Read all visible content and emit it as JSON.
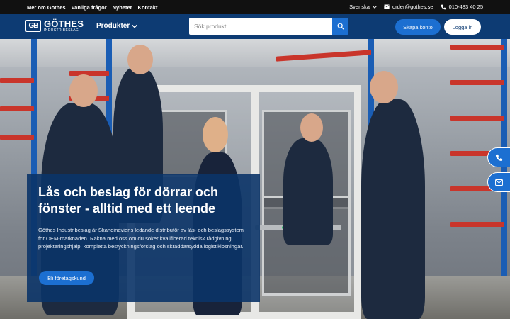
{
  "topbar": {
    "links": [
      "Mer om Göthes",
      "Vanliga frågor",
      "Nyheter",
      "Kontakt"
    ],
    "language": "Svenska",
    "email": "order@gothes.se",
    "phone": "010-483 40 25"
  },
  "header": {
    "logo_mark": "GB",
    "logo_brand": "GÖTHES",
    "logo_sub": "INDUSTRIBESLAG",
    "products_label": "Produkter",
    "search_placeholder": "Sök produkt",
    "create_account_label": "Skapa konto",
    "login_label": "Logga in"
  },
  "hero": {
    "title": "Lås och beslag för dörrar och fönster - alltid med ett leende",
    "description": "Göthes Industribeslag är Skandinaviens ledande distributör av lås- och beslagssystem för OEM-marknaden. Räkna med oss om du söker kvalificerad teknisk rådgivning, projekteringshjälp, kompletta bestyckningsförslag och skräddarsydda logistiklösningar.",
    "cta_label": "Bli företagskund"
  },
  "floating": {
    "phone_icon": "phone-icon",
    "email_icon": "mail-icon"
  },
  "colors": {
    "brand_navy": "#0d3b73",
    "accent_blue": "#1c6fd1",
    "topbar_black": "#111111"
  }
}
